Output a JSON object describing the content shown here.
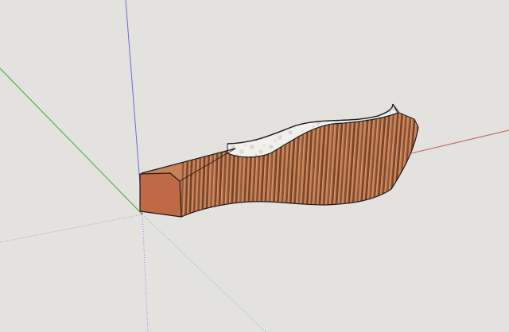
{
  "viewport": {
    "background_color": "#e3e2df"
  },
  "axes": {
    "red_color": "#c55a5a",
    "green_color": "#3aa83a",
    "blue_color": "#6a6ad6"
  },
  "model": {
    "slat_count": 58,
    "wood_light": "#c78257",
    "wood_dark": "#6d3b22",
    "wood_end_face": "#c06a45",
    "edge_color": "#1c1c1c",
    "seat_fill": "#f1f0ed",
    "seat_texture": "#c9c9c6"
  }
}
